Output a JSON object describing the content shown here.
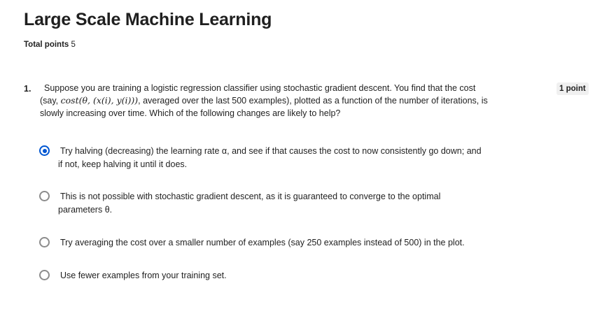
{
  "page": {
    "title": "Large Scale Machine Learning",
    "total_label": "Total points",
    "total_value": "5"
  },
  "question": {
    "number": "1.",
    "points": "1 point",
    "text_line1": "Suppose you are training a logistic regression classifier using stochastic gradient descent. You find that the cost",
    "text_line2_prefix": "(say, ",
    "text_line2_math": "cost(θ, (x(i), y(i)))",
    "text_line2_suffix": ", averaged over the last 500 examples), plotted as a function of the number of iterations, is",
    "text_line3": "slowly increasing over time.  Which of the following changes are likely to help?"
  },
  "options": [
    {
      "line1": "Try halving (decreasing) the learning rate α, and see if that causes the cost to now consistently go down; and",
      "line2": "if not, keep halving it until it does.",
      "selected": true
    },
    {
      "line1": "This is not possible with stochastic gradient descent, as it is guaranteed to converge to the optimal",
      "line2": "parameters θ.",
      "selected": false
    },
    {
      "line1": "Try averaging the cost over a smaller number of examples (say 250 examples instead of 500) in the plot.",
      "line2": "",
      "selected": false
    },
    {
      "line1": "Use fewer examples from your training set.",
      "line2": "",
      "selected": false
    }
  ],
  "colors": {
    "accent": "#0056d2",
    "radio_border": "#8c8c8c",
    "badge_bg": "#f0f0f0",
    "text": "#1f1f1f"
  }
}
